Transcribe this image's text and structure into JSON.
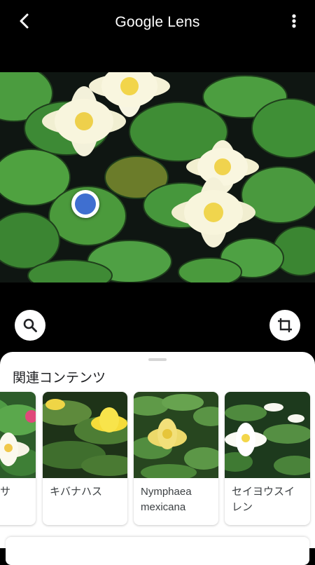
{
  "header": {
    "title": "Google Lens",
    "back_icon": "arrow-back-icon",
    "menu_icon": "more-vert-icon"
  },
  "tools": {
    "search_icon": "search-icon",
    "crop_icon": "crop-icon"
  },
  "related": {
    "title": "関連コンテンツ",
    "items": [
      {
        "label": "サ"
      },
      {
        "label": "キバナハス"
      },
      {
        "label": "Nymphaea mexicana"
      },
      {
        "label": "セイヨウスイレン"
      }
    ]
  }
}
